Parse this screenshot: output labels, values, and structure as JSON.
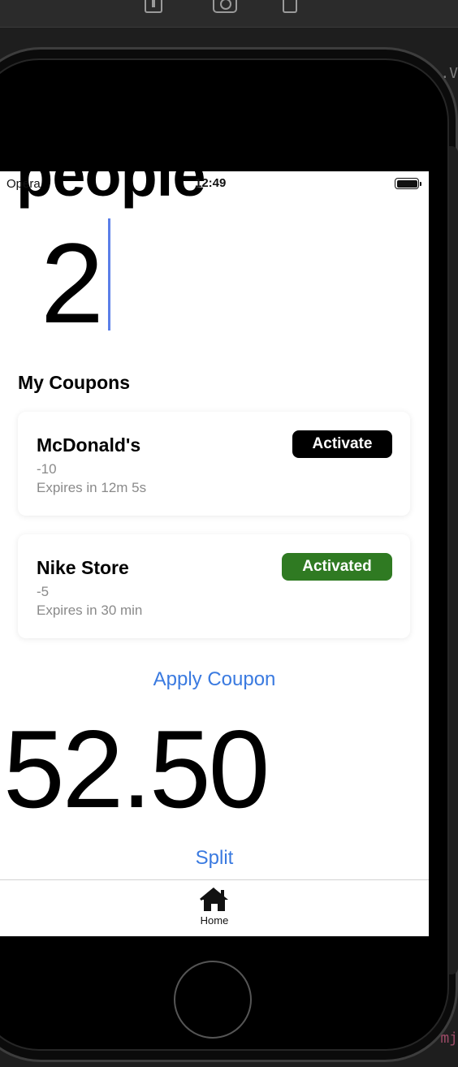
{
  "editor": {
    "fragment_top": "n.V",
    "fragment_bottom": "mj"
  },
  "simulator": {
    "toolbar_icons": [
      "home-icon",
      "screenshot-icon",
      "rotate-icon"
    ]
  },
  "status_bar": {
    "carrier": "Opera",
    "time": "12:49"
  },
  "heading": "people",
  "people_count": "2",
  "coupons_section": {
    "title": "My Coupons",
    "items": [
      {
        "name": "McDonald's",
        "value": "-10",
        "expiry": "Expires in 12m 5s",
        "button_label": "Activate",
        "button_color": "#000000"
      },
      {
        "name": "Nike Store",
        "value": "-5",
        "expiry": "Expires in 30 min",
        "button_label": "Activated",
        "button_color": "#2f7a22"
      }
    ]
  },
  "apply_coupon_label": "Apply Coupon",
  "total": "52.50",
  "split_label": "Split",
  "tab_bar": {
    "items": [
      {
        "label": "Home",
        "icon": "house-icon"
      }
    ]
  },
  "colors": {
    "link": "#3a7ae0",
    "activated": "#2f7a22",
    "caret": "#5b7fe8"
  }
}
